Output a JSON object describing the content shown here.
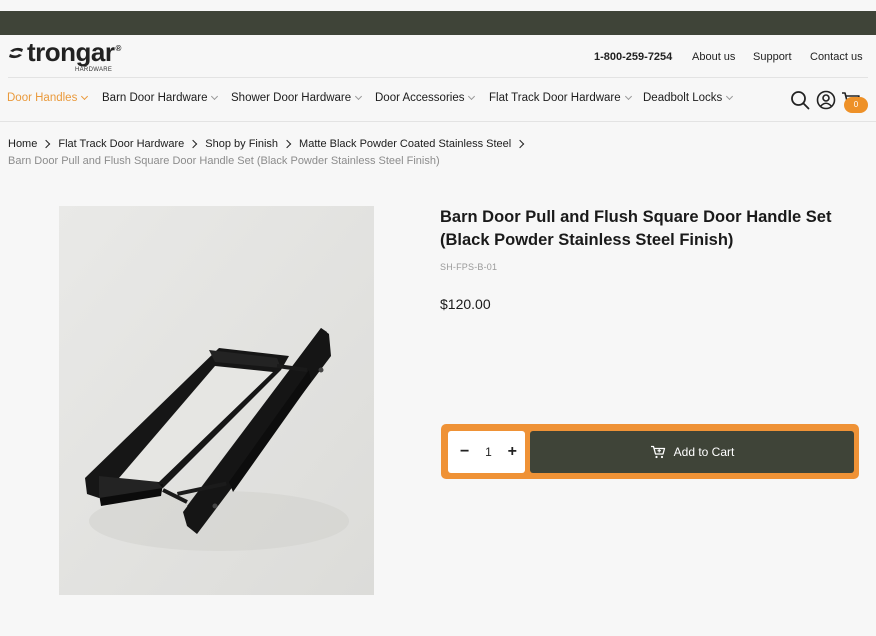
{
  "brand": {
    "name": "trongar",
    "sub": "HARDWARE",
    "reg": "®"
  },
  "header": {
    "phone": "1-800-259-7254",
    "about": "About us",
    "support": "Support",
    "contact": "Contact us"
  },
  "nav": {
    "items": [
      {
        "label": "Door Handles",
        "active": true
      },
      {
        "label": "Barn Door Hardware"
      },
      {
        "label": "Shower Door Hardware"
      },
      {
        "label": "Door Accessories"
      },
      {
        "label": "Flat Track Door Hardware"
      },
      {
        "label": "Deadbolt Locks"
      }
    ],
    "cart_count": "0",
    "icons": [
      "search-icon",
      "account-icon",
      "cart-icon"
    ]
  },
  "breadcrumb": {
    "items": [
      "Home",
      "Flat Track Door Hardware",
      "Shop by Finish",
      "Matte Black Powder Coated Stainless Steel"
    ],
    "current": "Barn Door Pull and Flush Square Door Handle Set (Black Powder Stainless Steel Finish)"
  },
  "product": {
    "title": "Barn Door Pull and Flush Square Door Handle Set (Black Powder Stainless Steel Finish)",
    "sku": "SH-FPS-B-01",
    "price": "$120.00",
    "quantity": "1",
    "minus": "−",
    "plus": "+",
    "add_to_cart": "Add to Cart"
  },
  "colors": {
    "topbar": "#3f4438",
    "accent": "#ef9236",
    "button": "#3f4438",
    "nav_active": "#ea9a3c"
  }
}
